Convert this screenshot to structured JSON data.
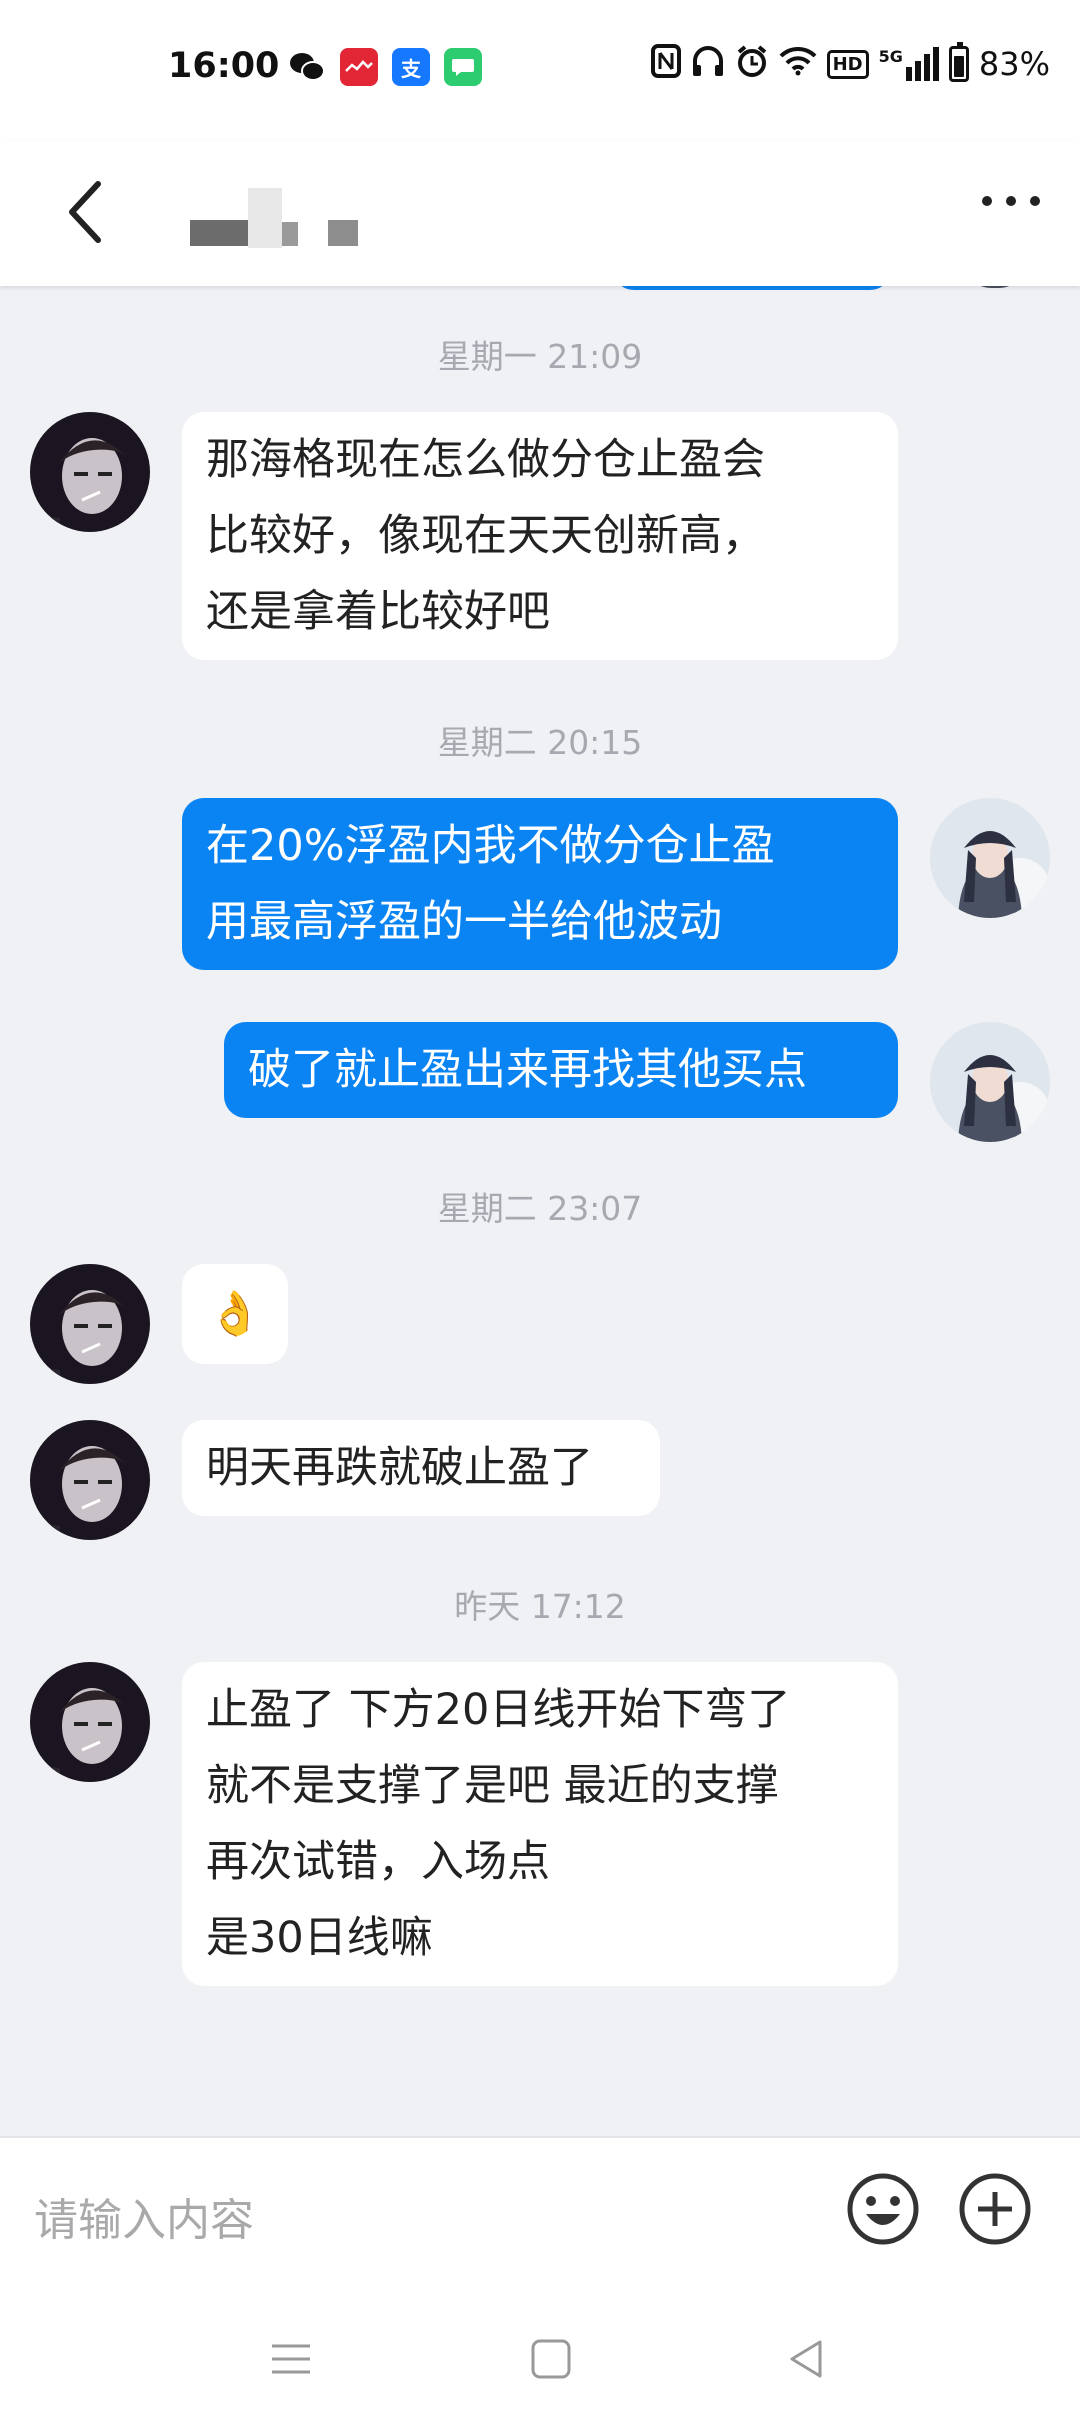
{
  "status_bar": {
    "time": "16:00",
    "network": "5G",
    "hd_label": "HD",
    "battery": "83%",
    "apps": [
      "wechat-icon",
      "stock-app-icon",
      "alipay-icon",
      "message-app-icon"
    ],
    "icons": [
      "nfc-icon",
      "headphones-icon",
      "alarm-icon",
      "wifi-icon",
      "signal-icon",
      "battery-icon"
    ]
  },
  "header": {
    "back": "back-arrow-icon",
    "more": "more-icon"
  },
  "messages": [
    {
      "type": "time",
      "text": "星期一 21:09"
    },
    {
      "type": "in",
      "lines": [
        "那海格现在怎么做分仓止盈会",
        "比较好，像现在天天创新高，",
        "还是拿着比较好吧"
      ]
    },
    {
      "type": "time",
      "text": "星期二 20:15"
    },
    {
      "type": "out",
      "lines": [
        "在20%浮盈内我不做分仓止盈",
        "用最高浮盈的一半给他波动"
      ]
    },
    {
      "type": "out",
      "lines": [
        "破了就止盈出来再找其他买点"
      ]
    },
    {
      "type": "time",
      "text": "星期二 23:07"
    },
    {
      "type": "in",
      "lines": [
        "👌"
      ]
    },
    {
      "type": "in",
      "lines": [
        "明天再跌就破止盈了"
      ]
    },
    {
      "type": "time",
      "text": "昨天 17:12"
    },
    {
      "type": "in",
      "lines": [
        "止盈了 下方20日线开始下弯了",
        "就不是支撑了是吧 最近的支撑",
        "再次试错，入场点",
        "是30日线嘛"
      ]
    }
  ],
  "input": {
    "placeholder": "请输入内容",
    "emoji": "emoji-icon",
    "plus": "plus-icon"
  },
  "colors": {
    "accent": "#0b84f3",
    "background": "#f0f1f5",
    "timestamp": "#a6a9b0"
  }
}
